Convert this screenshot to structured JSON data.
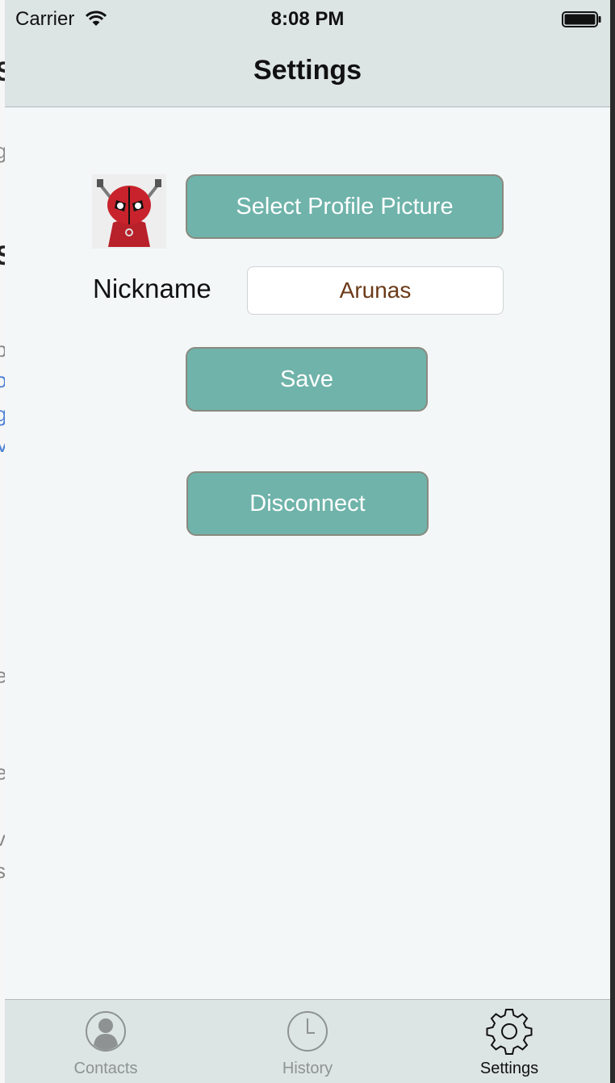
{
  "status_bar": {
    "carrier": "Carrier",
    "time": "8:08 PM"
  },
  "nav": {
    "title": "Settings"
  },
  "profile": {
    "select_button": "Select Profile Picture"
  },
  "nickname": {
    "label": "Nickname",
    "value": "Arunas"
  },
  "actions": {
    "save": "Save",
    "disconnect": "Disconnect"
  },
  "tabs": [
    {
      "label": "Contacts",
      "icon": "person-icon",
      "active": false
    },
    {
      "label": "History",
      "icon": "clock-icon",
      "active": false
    },
    {
      "label": "Settings",
      "icon": "gear-icon",
      "active": true
    }
  ],
  "colors": {
    "button_fill": "#6fb3aa",
    "button_border": "#8a8a80",
    "bar_background": "#dde4e4",
    "screen_background": "#f3f7f8",
    "nickname_text": "#6b3a18",
    "inactive_tab": "#8e9292"
  }
}
